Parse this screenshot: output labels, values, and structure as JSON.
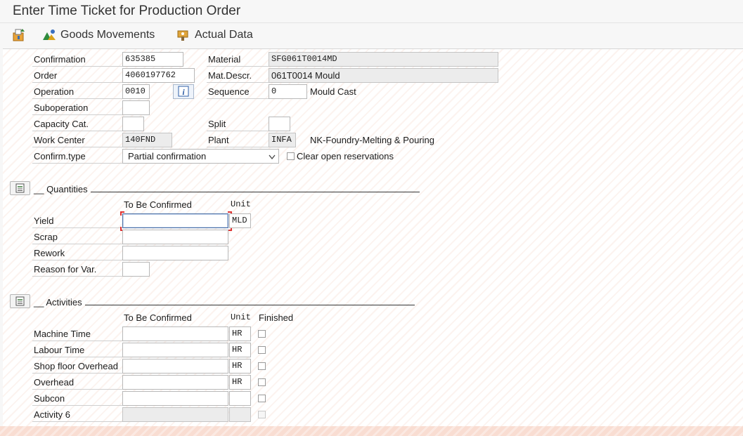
{
  "window": {
    "title": "Enter Time Ticket for Production Order"
  },
  "toolbar": {
    "goods_movements": "Goods Movements",
    "actual_data": "Actual Data"
  },
  "header": {
    "confirmation_label": "Confirmation",
    "confirmation": "635385",
    "order_label": "Order",
    "order": "4060197762",
    "operation_label": "Operation",
    "operation": "0010",
    "suboperation_label": "Suboperation",
    "suboperation": "",
    "capacity_label": "Capacity Cat.",
    "capacity": "",
    "work_center_label": "Work Center",
    "work_center": "140FND",
    "confirm_type_label": "Confirm.type",
    "confirm_type": "Partial confirmation",
    "material_label": "Material",
    "material": "SFG061T0014MD",
    "matdescr_label": "Mat.Descr.",
    "matdescr": "061T0014 Mould",
    "sequence_label": "Sequence",
    "sequence": "0",
    "sequence_text": "Mould Cast",
    "split_label": "Split",
    "split": "",
    "plant_label": "Plant",
    "plant": "INFA",
    "plant_text": "NK-Foundry-Melting & Pouring",
    "clear_reservations": "Clear open reservations"
  },
  "quantities": {
    "title": "__ Quantities",
    "col_confirmed": "To Be Confirmed",
    "col_unit": "Unit",
    "yield_label": "Yield",
    "yield": "",
    "yield_unit": "MLD",
    "scrap_label": "Scrap",
    "scrap": "",
    "rework_label": "Rework",
    "rework": "",
    "reason_label": "Reason for Var.",
    "reason": ""
  },
  "activities": {
    "title": "__ Activities",
    "col_confirmed": "To Be Confirmed",
    "col_unit": "Unit",
    "col_finished": "Finished",
    "rows": [
      {
        "label": "Machine Time",
        "value": "",
        "unit": "HR"
      },
      {
        "label": "Labour Time",
        "value": "",
        "unit": "HR"
      },
      {
        "label": "Shop floor Overhead",
        "value": "",
        "unit": "HR"
      },
      {
        "label": "Overhead",
        "value": "",
        "unit": "HR"
      },
      {
        "label": "Subcon",
        "value": "",
        "unit": ""
      },
      {
        "label": "Activity 6",
        "value": "",
        "unit": ""
      }
    ]
  },
  "icons": {
    "toolbar_first": "save-post-icon",
    "goods_movements": "goods-movements-icon",
    "actual_data": "actual-data-icon",
    "info": "info-icon",
    "section_toggle": "section-toggle-icon"
  }
}
